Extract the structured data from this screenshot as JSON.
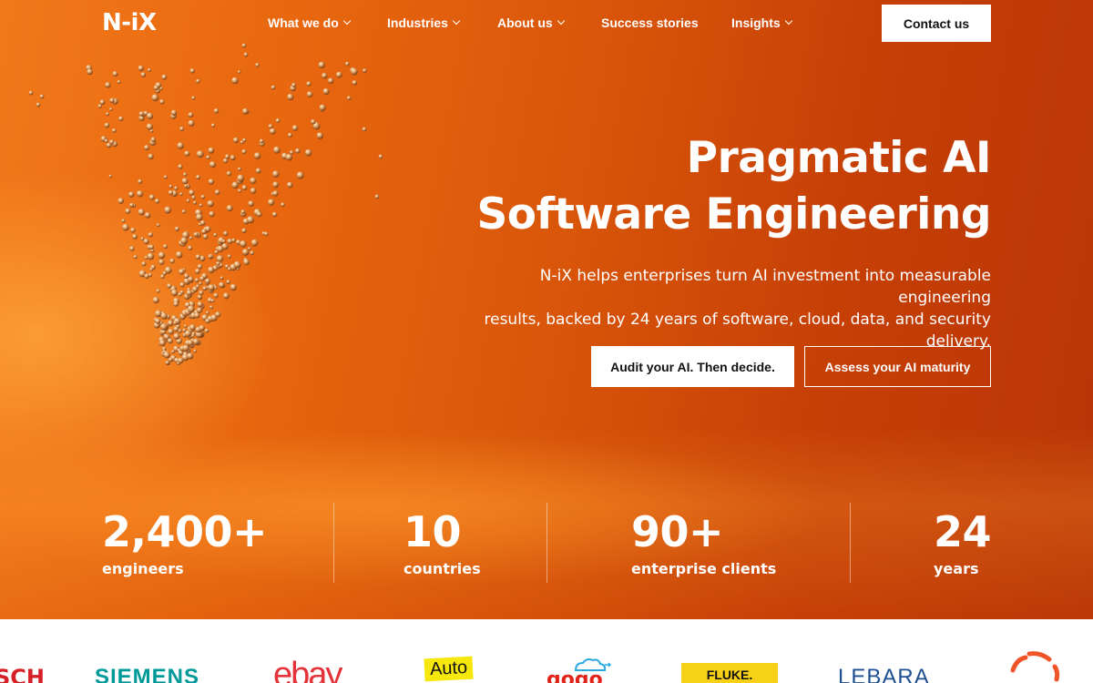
{
  "header": {
    "logo": "N-iX",
    "nav": [
      {
        "label": "What we do",
        "dropdown": true
      },
      {
        "label": "Industries",
        "dropdown": true
      },
      {
        "label": "About us",
        "dropdown": true
      },
      {
        "label": "Success stories",
        "dropdown": false
      },
      {
        "label": "Insights",
        "dropdown": true
      }
    ],
    "contact_label": "Contact us"
  },
  "hero": {
    "title_line1": "Pragmatic AI",
    "title_line2": "Software Engineering",
    "subtitle_line1": "N-iX helps enterprises turn AI investment into measurable engineering",
    "subtitle_line2": "results, backed by 24 years of software, cloud, data, and security delivery.",
    "primary_cta": "Audit your AI. Then decide.",
    "secondary_cta": "Assess your AI maturity"
  },
  "stats": [
    {
      "value": "2,400+",
      "label": "engineers"
    },
    {
      "value": "10",
      "label": "countries"
    },
    {
      "value": "90+",
      "label": "enterprise clients"
    },
    {
      "value": "24",
      "label": "years"
    }
  ],
  "client_logos": [
    {
      "name": "SCH",
      "color": "#d61f26"
    },
    {
      "name": "SIEMENS",
      "color": "#009999"
    },
    {
      "name": "ebay",
      "color": "#e53238"
    },
    {
      "name": "Auto",
      "color": "#111111"
    },
    {
      "name": "gogo",
      "color": "#e2231a"
    },
    {
      "name": "FLUKE.",
      "color": "#111111"
    },
    {
      "name": "LEBARA",
      "color": "#1d4f91"
    }
  ],
  "colors": {
    "hero_orange": "#e8670f",
    "hero_red": "#b93506",
    "particle": "#e2a060"
  }
}
